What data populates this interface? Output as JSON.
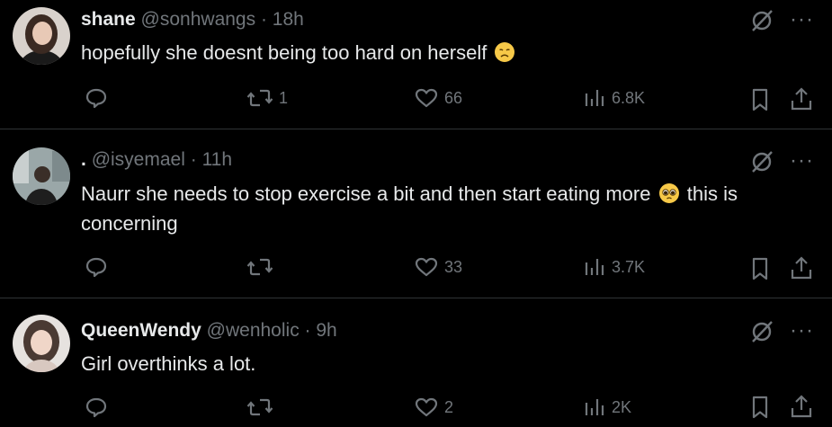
{
  "replies": [
    {
      "name": "shane",
      "handle": "@sonhwangs",
      "sep": "·",
      "time": "18h",
      "text": "hopefully she doesnt being too hard on herself",
      "text2": "",
      "emoji": "disappointed-face-icon",
      "retweets": "1",
      "likes": "66",
      "views": "6.8K"
    },
    {
      "name": ".",
      "handle": "@isyemael",
      "sep": "·",
      "time": "11h",
      "text": "Naurr she needs to stop exercise a bit and then start eating more",
      "text2": "this is concerning",
      "emoji": "pleading-face-icon",
      "retweets": "",
      "likes": "33",
      "views": "3.7K"
    },
    {
      "name": "QueenWendy",
      "handle": "@wenholic",
      "sep": "·",
      "time": "9h",
      "text": "Girl overthinks a lot.",
      "text2": "",
      "emoji": "",
      "retweets": "",
      "likes": "2",
      "views": "2K"
    }
  ],
  "more_glyph": "···",
  "colors": {
    "background": "#000000",
    "text": "#e7e9ea",
    "muted": "#71767b",
    "divider": "#2f3336",
    "emoji": "#f7c948"
  }
}
